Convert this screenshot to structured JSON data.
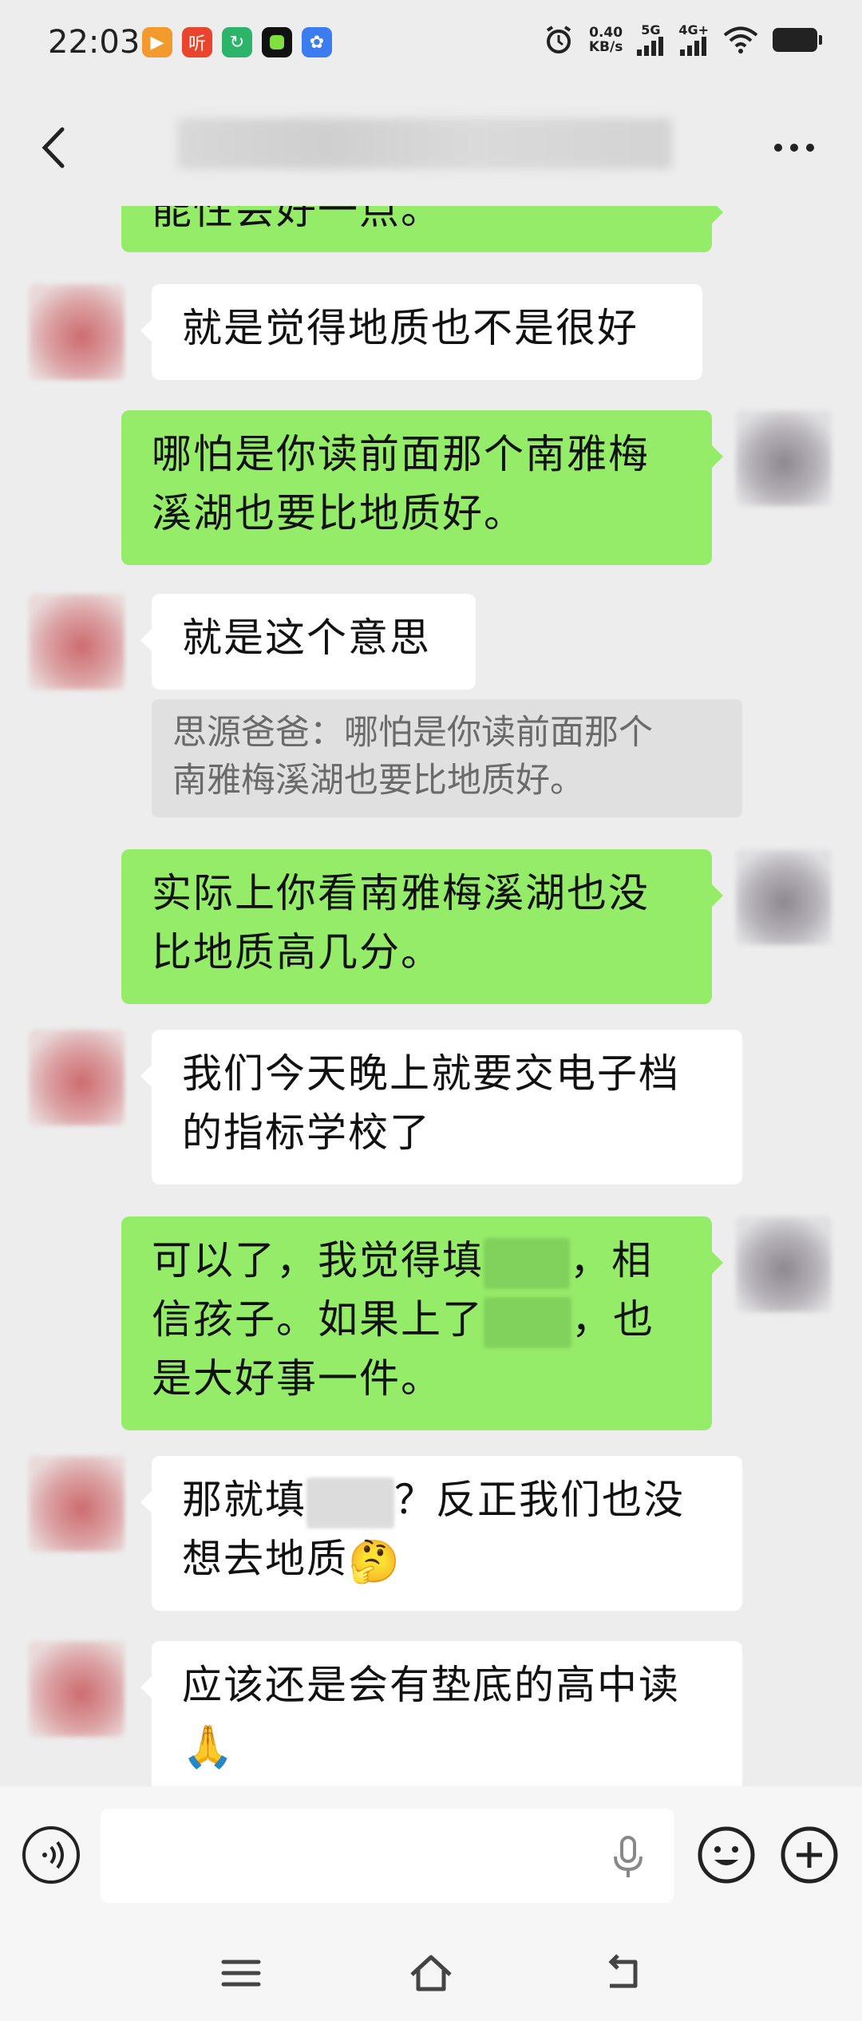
{
  "status_bar": {
    "time": "22:03",
    "net_speed_value": "0.40",
    "net_speed_unit": "KB/s",
    "signal_1": "5G",
    "signal_2": "4G+",
    "app_icons": [
      {
        "name": "video-app-icon",
        "color": "#f29a2e"
      },
      {
        "name": "listen-app-icon",
        "glyph": "听",
        "color": "#e8452c"
      },
      {
        "name": "green-app-icon",
        "color": "#2db46b"
      },
      {
        "name": "black-app-icon",
        "color": "#111111"
      },
      {
        "name": "baidu-app-icon",
        "color": "#3b7cf0"
      }
    ]
  },
  "header": {
    "back_icon": "chevron-left-icon",
    "more_icon": "more-dots-icon"
  },
  "messages": [
    {
      "side": "me",
      "text": "能性会好一点。"
    },
    {
      "side": "other",
      "text": "就是觉得地质也不是很好"
    },
    {
      "side": "me",
      "lines": [
        "哪怕是你读前面那个南雅梅",
        "溪湖也要比地质好。"
      ]
    },
    {
      "side": "other",
      "text": "就是这个意思"
    },
    {
      "side": "quote",
      "lines": [
        "思源爸爸：哪怕是你读前面那个",
        "南雅梅溪湖也要比地质好。"
      ]
    },
    {
      "side": "me",
      "lines": [
        "实际上你看南雅梅溪湖也没",
        "比地质高几分。"
      ]
    },
    {
      "side": "other",
      "lines": [
        "我们今天晚上就要交电子档",
        "的指标学校了"
      ]
    },
    {
      "side": "me",
      "parts": {
        "l1a": "可以了，我觉得填",
        "l1b": "，相",
        "l2a": "信孩子。如果上了",
        "l2b": "，也",
        "l3": "是大好事一件。"
      }
    },
    {
      "side": "other",
      "parts": {
        "l1a": "那就填",
        "l1b": "？反正我们也没",
        "l2": "想去地质",
        "emoji": "🤔"
      }
    },
    {
      "side": "other",
      "parts": {
        "l1": "应该还是会有垫底的高中读",
        "emoji": "🙏"
      }
    }
  ],
  "input_bar": {
    "voice_icon": "voice-icon",
    "placeholder": "",
    "mic_icon": "mic-icon",
    "emoji_icon": "smiley-icon",
    "plus_icon": "plus-icon"
  },
  "system_nav": {
    "menu_icon": "menu-icon",
    "home_icon": "home-icon",
    "back_icon": "back-icon"
  }
}
